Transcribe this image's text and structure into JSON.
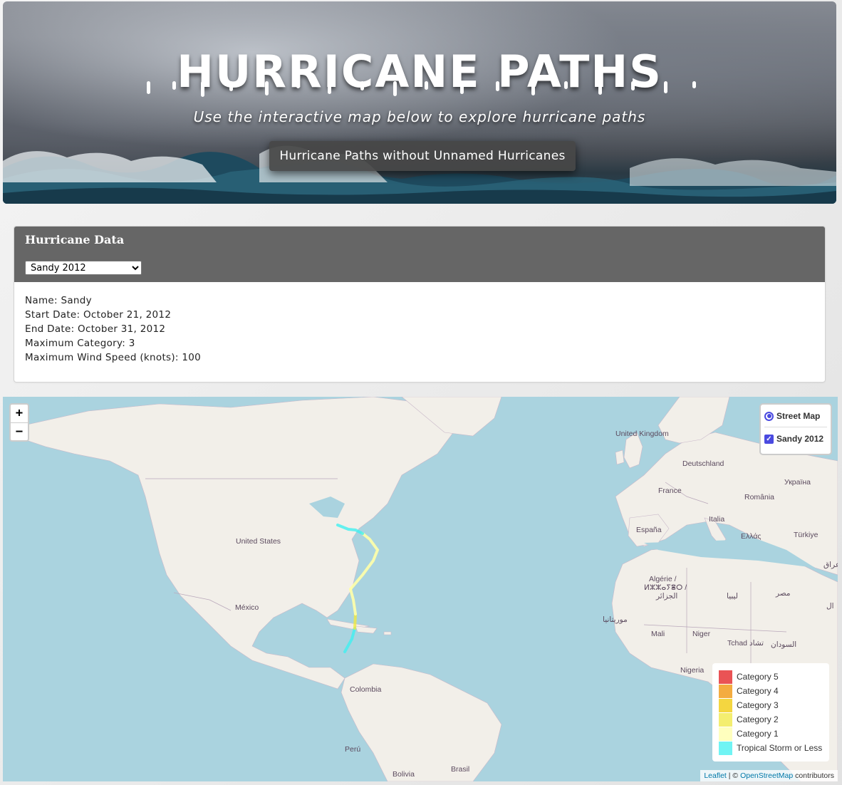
{
  "hero": {
    "title": "HURRICANE PATHS",
    "subtitle": "Use the interactive map below to explore hurricane paths",
    "button_label": "Hurricane Paths without Unnamed Hurricanes"
  },
  "panel": {
    "title": "Hurricane Data",
    "selected_hurricane": "Sandy 2012",
    "info": {
      "name": "Name: Sandy",
      "start_date": "Start Date: October 21, 2012",
      "end_date": "End Date: October 31, 2012",
      "max_category": "Maximum Category: 3",
      "max_wind": "Maximum Wind Speed (knots): 100"
    }
  },
  "map": {
    "zoom_in": "+",
    "zoom_out": "−",
    "layers": {
      "base_layer": "Street Map",
      "overlay": "Sandy 2012"
    },
    "labels": {
      "united_kingdom": "United Kingdom",
      "deutschland": "Deutschland",
      "ukraina": "Україна",
      "france": "France",
      "romania": "România",
      "italia": "Italia",
      "espana": "España",
      "ellas": "Ελλάς",
      "turkiye": "Türkiye",
      "iraq": "عراق",
      "united_states": "United States",
      "mexico": "México",
      "algerie1": "Algérie /",
      "algerie2": "ⵍⵣⵣⴰⵢⴻⵔ /",
      "algerie3": "الجزائر",
      "libya": "ليبيا",
      "misr": "مصر",
      "saudi": "ال",
      "mauritania": "موريتانيا",
      "mali": "Mali",
      "niger": "Niger",
      "tchad": "Tchad تشاد",
      "sudan": "السودان",
      "nigeria": "Nigeria",
      "colombia": "Colombia",
      "peru": "Perú",
      "bolivia": "Bolivia",
      "brasil": "Brasil"
    },
    "legend": [
      {
        "label": "Category 5",
        "color": "#e31a1c"
      },
      {
        "label": "Category 4",
        "color": "#f09000"
      },
      {
        "label": "Category 3",
        "color": "#f0c800"
      },
      {
        "label": "Category 2",
        "color": "#f0e840"
      },
      {
        "label": "Category 1",
        "color": "#ffffa8"
      },
      {
        "label": "Tropical Storm or Less",
        "color": "#40f0f0"
      }
    ],
    "attribution": {
      "leaflet": "Leaflet",
      "sep": " | © ",
      "osm": "OpenStreetMap",
      "contributors": " contributors"
    }
  }
}
